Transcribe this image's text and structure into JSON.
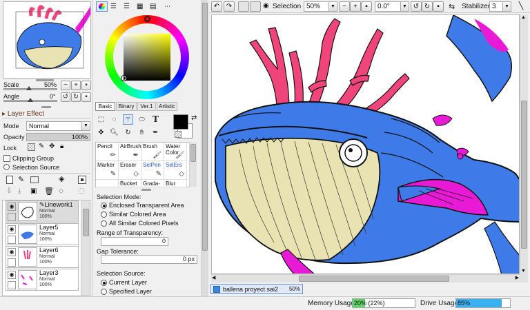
{
  "navigator": {
    "scale_label": "Scale",
    "scale_value": "50%",
    "angle_label": "Angle",
    "angle_value": "0°"
  },
  "layer_effect": {
    "header": "Layer Effect",
    "mode_label": "Mode",
    "mode_value": "Normal",
    "opacity_label": "Opacity",
    "opacity_value": "100%",
    "opacity_fraction": 1.0,
    "lock_label": "Lock",
    "clipping_group": "Clipping Group",
    "selection_source": "Selection Source"
  },
  "layers": [
    {
      "name": "Linework1",
      "mode": "Normal",
      "opacity": "100%"
    },
    {
      "name": "Layer5",
      "mode": "Normal",
      "opacity": "100%"
    },
    {
      "name": "Layer6",
      "mode": "Normal",
      "opacity": "100%"
    },
    {
      "name": "Layer3",
      "mode": "Normal",
      "opacity": "100%"
    }
  ],
  "color_tabs": {
    "basic": "Basic",
    "binary": "Binary",
    "ver1": "Ver.1",
    "artistic": "Artistic"
  },
  "tools_text_glyph": "T",
  "brushes": [
    {
      "label": "Pencil"
    },
    {
      "label": "AirBrush"
    },
    {
      "label": "Brush"
    },
    {
      "label": "Water Color"
    },
    {
      "label": "Marker"
    },
    {
      "label": "Eraser"
    },
    {
      "label": "SelPen"
    },
    {
      "label": "SelErs"
    },
    {
      "label": ""
    },
    {
      "label": "Bucket"
    },
    {
      "label": "Grada-"
    },
    {
      "label": "Blur"
    }
  ],
  "selection_panel": {
    "mode_header": "Selection Mode:",
    "opt_enclosed": "Enclosed Transparent Area",
    "opt_similar": "Similar Colored Area",
    "opt_all": "All Similar Colored Pixels",
    "range_label": "Range of Transparency:",
    "range_value": "0",
    "gap_label": "Gap Tolerance:",
    "gap_value": "0 px",
    "source_header": "Selection Source:",
    "opt_current": "Current Layer",
    "opt_specified": "Specified Layer"
  },
  "toolbar": {
    "selection_label": "Selection",
    "zoom_value": "50%",
    "angle_value": "0.0°",
    "stabilizer_label": "Stabilizer",
    "stabilizer_value": "3"
  },
  "document_tab": {
    "filename": "ballena proyect.sai2",
    "zoom": "50%"
  },
  "status": {
    "memory_label": "Memory Usage",
    "memory_value": "20%",
    "memory_detail": "(22%)",
    "memory_fraction": 0.2,
    "drive_label": "Drive Usage",
    "drive_value": "85%",
    "drive_fraction": 0.85
  },
  "colors": {
    "accent_blue": "#3a86e0",
    "whale_blue": "#3f7be8",
    "coral_pink": "#f0457a",
    "magenta": "#e81ad6",
    "belly": "#e9e3b4",
    "memory_green": "#5fd46a",
    "drive_blue": "#3ab0f0"
  }
}
